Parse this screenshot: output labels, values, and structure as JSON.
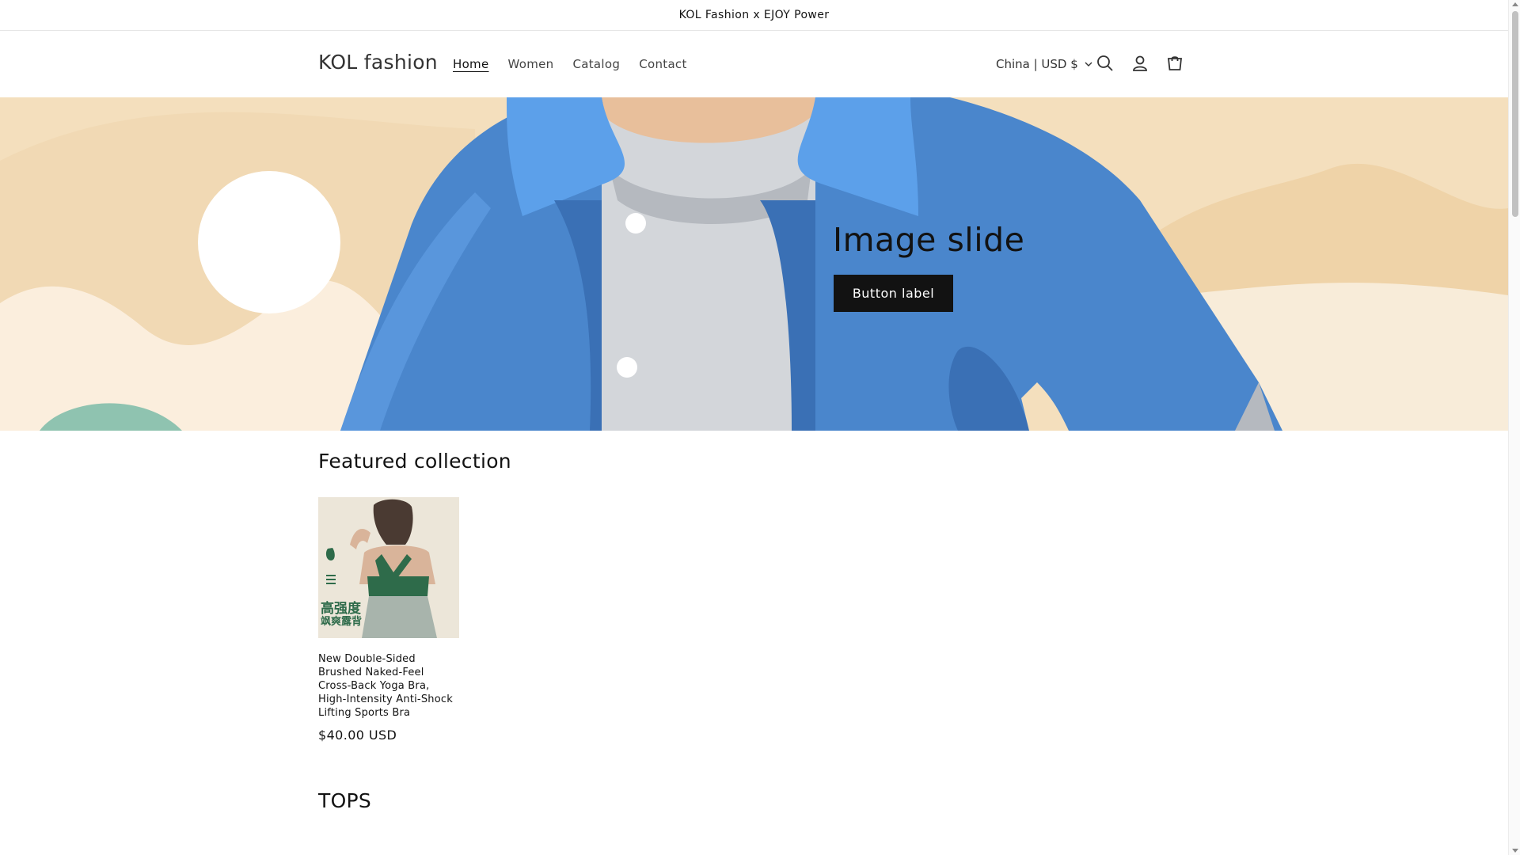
{
  "announcement": {
    "text": "KOL Fashion x EJOY Power"
  },
  "header": {
    "logo": "KOL fashion",
    "nav": [
      {
        "label": "Home",
        "active": true
      },
      {
        "label": "Women",
        "active": false
      },
      {
        "label": "Catalog",
        "active": false
      },
      {
        "label": "Contact",
        "active": false
      }
    ],
    "locale": "China | USD $",
    "icons": [
      "search-icon",
      "account-icon",
      "cart-icon"
    ]
  },
  "hero": {
    "title": "Image slide",
    "button_label": "Button label",
    "colors": {
      "background": "#f4dfbd",
      "jacket": "#4a86cc",
      "shirt": "#d3d6da"
    }
  },
  "featured": {
    "title": "Featured collection",
    "products": [
      {
        "title": "New Double-Sided Brushed Naked-Feel Cross-Back Yoga Bra, High-Intensity Anti-Shock Lifting Sports Bra",
        "price": "$40.00 USD",
        "image_text_1": "高强度",
        "image_text_2": "飒爽露背"
      }
    ]
  },
  "tops": {
    "title": "TOPS"
  },
  "colors": {
    "accent": "#121212",
    "border": "#e6e6e6"
  }
}
